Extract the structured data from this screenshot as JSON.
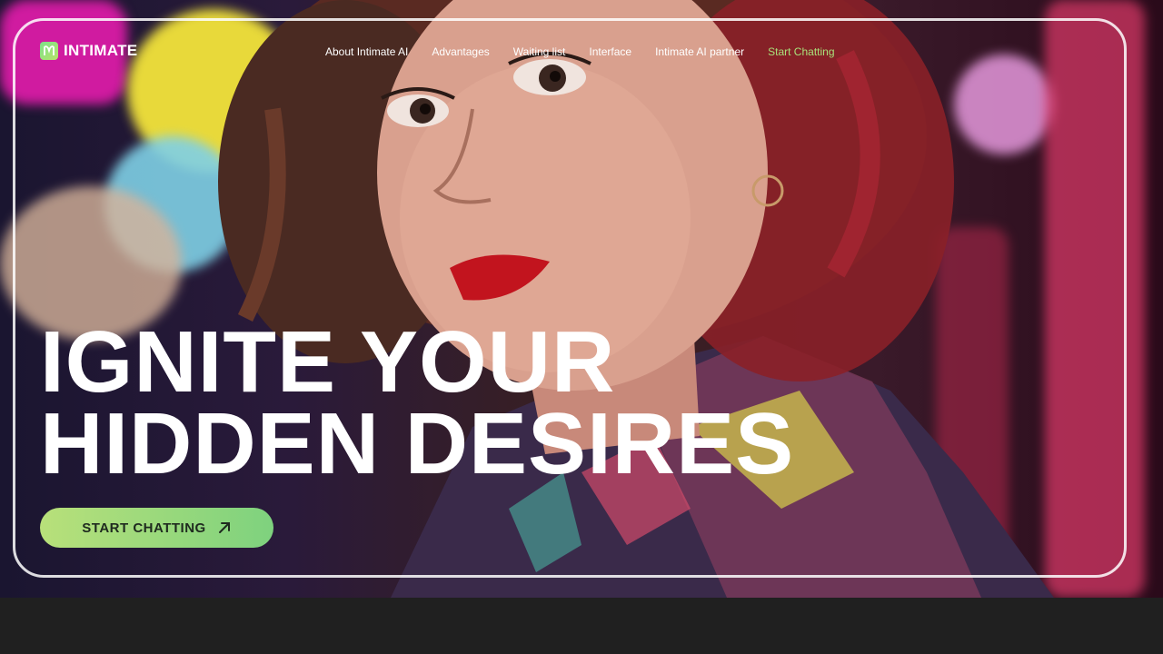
{
  "brand": {
    "name": "INTIMATE",
    "icon": "logo-mark-icon"
  },
  "nav": {
    "items": [
      {
        "label": "About Intimate AI"
      },
      {
        "label": "Advantages"
      },
      {
        "label": "Waiting list"
      },
      {
        "label": "Interface"
      },
      {
        "label": "Intimate AI partner"
      },
      {
        "label": "Start Chatting",
        "accent": true
      }
    ]
  },
  "hero": {
    "headline_line1": "IGNITE YOUR",
    "headline_line2": "HIDDEN DESIRES",
    "cta_label": "START CHATTING",
    "cta_icon": "arrow-up-right-icon"
  },
  "colors": {
    "accent": "#a8e07a",
    "cta_start": "#b8e07a",
    "cta_end": "#7ed27e",
    "background": "#202020"
  }
}
